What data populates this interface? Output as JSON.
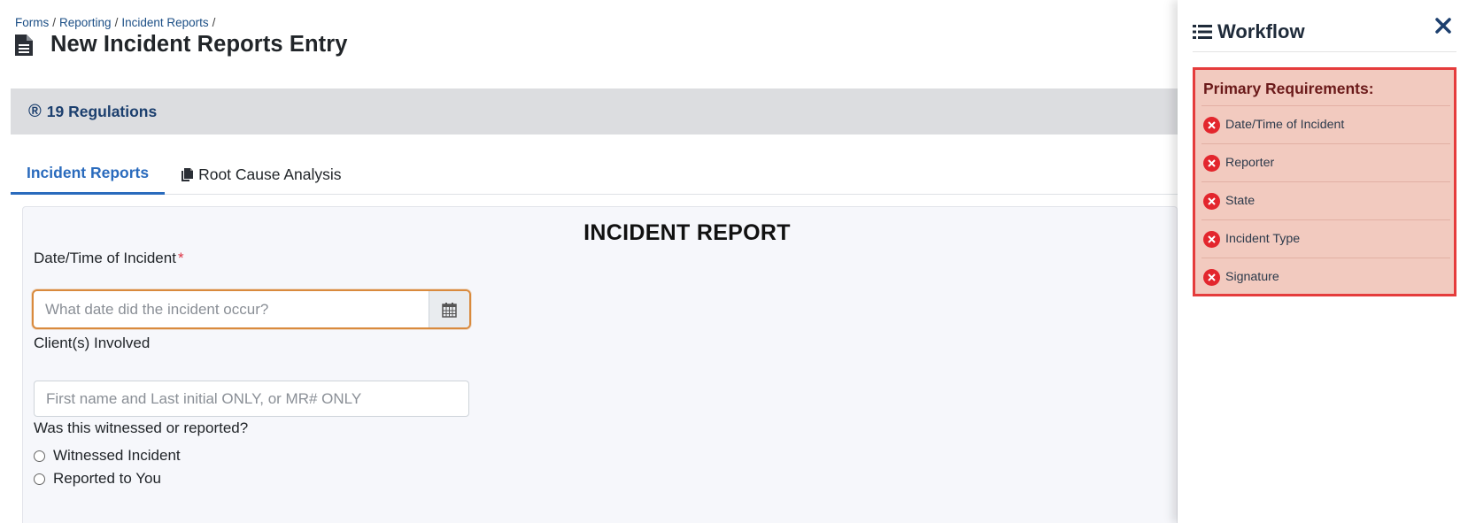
{
  "breadcrumb": {
    "items": [
      "Forms",
      "Reporting",
      "Incident Reports"
    ],
    "separator": "/"
  },
  "header": {
    "icon": "document-icon",
    "title": "New Incident Reports Entry"
  },
  "regulations": {
    "icon_glyph": "®",
    "label": "19 Regulations"
  },
  "tabs": [
    {
      "label": "Incident Reports",
      "active": true
    },
    {
      "label": "Root Cause Analysis",
      "icon": "copy-documents-icon",
      "active": false
    }
  ],
  "form": {
    "heading": "INCIDENT REPORT",
    "date_field": {
      "label": "Date/Time of Incident",
      "required_marker": "*",
      "placeholder": "What date did the incident occur?",
      "value": "",
      "icon": "calendar-icon"
    },
    "client_field": {
      "label": "Client(s) Involved",
      "placeholder": "First name and Last initial ONLY, or MR# ONLY",
      "value": ""
    },
    "witness_question": {
      "label": "Was this witnessed or reported?",
      "options": [
        "Witnessed Incident",
        "Reported to You"
      ]
    }
  },
  "workflow": {
    "title": "Workflow",
    "icon": "list-icon",
    "close_icon": "close-icon",
    "panel_title": "Primary Requirements:",
    "requirements": [
      {
        "label": "Date/Time of Incident",
        "status": "missing"
      },
      {
        "label": "Reporter",
        "status": "missing"
      },
      {
        "label": "State",
        "status": "missing"
      },
      {
        "label": "Incident Type",
        "status": "missing"
      },
      {
        "label": "Signature",
        "status": "missing"
      }
    ]
  },
  "colors": {
    "link": "#1c4f86",
    "tab_active": "#2a6bbd",
    "error": "#e3262d",
    "panel_bg": "#f2cabf",
    "focus_border": "#d98a3d"
  }
}
